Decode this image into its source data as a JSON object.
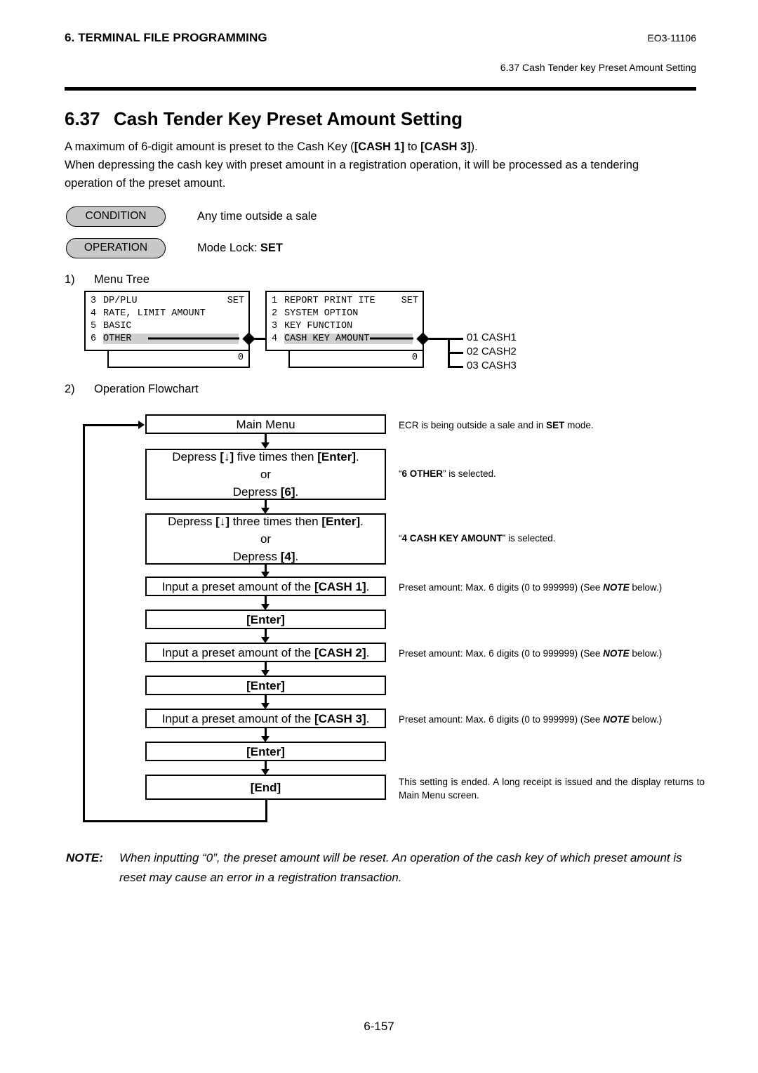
{
  "header": {
    "chapter": "6. TERMINAL FILE PROGRAMMING",
    "doc_code": "EO3-11106",
    "running_head": "6.37 Cash Tender key Preset Amount Setting"
  },
  "section": {
    "number": "6.37",
    "title": "Cash Tender Key Preset Amount Setting",
    "intro_line1_pre": "A maximum of 6-digit amount is preset to the Cash Key (",
    "intro_key1": "[CASH 1]",
    "intro_line1_mid": " to ",
    "intro_key2": "[CASH 3]",
    "intro_line1_post": ").",
    "intro_line2": "When depressing the cash key with preset amount in a registration operation, it will be processed as a tendering",
    "intro_line3": "operation of the preset amount."
  },
  "condition": {
    "badge": "CONDITION",
    "text": "Any time outside a sale"
  },
  "operation": {
    "badge": "OPERATION",
    "text_pre": "Mode Lock: ",
    "text_bold": "SET"
  },
  "subsections": {
    "one_index": "1)",
    "one_label": "Menu Tree",
    "two_index": "2)",
    "two_label": "Operation Flowchart"
  },
  "menu_tree": {
    "panel1": {
      "rows": [
        {
          "index": "3",
          "label": "DP/PLU",
          "right": "SET",
          "selected": false
        },
        {
          "index": "4",
          "label": "RATE, LIMIT AMOUNT",
          "right": "",
          "selected": false
        },
        {
          "index": "5",
          "label": "BASIC",
          "right": "",
          "selected": false
        },
        {
          "index": "6",
          "label": "OTHER",
          "right": "",
          "selected": true
        }
      ],
      "input_value": "0"
    },
    "panel2": {
      "rows": [
        {
          "index": "1",
          "label": "REPORT PRINT ITE",
          "right": "SET",
          "selected": false
        },
        {
          "index": "2",
          "label": "SYSTEM OPTION",
          "right": "",
          "selected": false
        },
        {
          "index": "3",
          "label": "KEY FUNCTION",
          "right": "",
          "selected": false
        },
        {
          "index": "4",
          "label": "CASH KEY AMOUNT",
          "right": "",
          "selected": true
        }
      ],
      "input_value": "0"
    },
    "branches": [
      "01 CASH1",
      "02 CASH2",
      "03 CASH3"
    ]
  },
  "flowchart": {
    "steps": [
      {
        "name": "main-menu",
        "lines": [
          {
            "text": "Main Menu",
            "bold": false
          }
        ],
        "note": "ECR is being outside a sale and in SET mode.",
        "note_bold": "SET"
      },
      {
        "name": "select-other",
        "lines": [
          {
            "text": "Depress [↓] five times then [Enter].",
            "bold": false
          },
          {
            "text": "or",
            "bold": false
          },
          {
            "text": "Depress [6].",
            "bold": false
          }
        ],
        "note": "“6 OTHER” is selected.",
        "note_bold": "6 OTHER"
      },
      {
        "name": "select-cash-key-amount",
        "lines": [
          {
            "text": "Depress [↓] three times then [Enter].",
            "bold": false
          },
          {
            "text": "or",
            "bold": false
          },
          {
            "text": "Depress [4].",
            "bold": false
          }
        ],
        "note": "“4 CASH KEY AMOUNT” is selected.",
        "note_bold": "4 CASH KEY AMOUNT"
      },
      {
        "name": "input-cash1",
        "lines": [
          {
            "text": "Input a preset amount of the [CASH 1].",
            "bold": false
          }
        ],
        "note": "Preset amount: Max. 6 digits (0 to 999999) (See NOTE below.)",
        "note_bold": "NOTE"
      },
      {
        "name": "enter-1",
        "lines": [
          {
            "text": "[Enter]",
            "bold": true
          }
        ],
        "note": ""
      },
      {
        "name": "input-cash2",
        "lines": [
          {
            "text": "Input a preset amount of the [CASH 2].",
            "bold": false
          }
        ],
        "note": "Preset amount: Max. 6 digits (0 to 999999) (See NOTE below.)",
        "note_bold": "NOTE"
      },
      {
        "name": "enter-2",
        "lines": [
          {
            "text": "[Enter]",
            "bold": true
          }
        ],
        "note": ""
      },
      {
        "name": "input-cash3",
        "lines": [
          {
            "text": "Input a preset amount of the [CASH 3].",
            "bold": false
          }
        ],
        "note": "Preset amount: Max. 6 digits (0 to 999999) (See NOTE below.)",
        "note_bold": "NOTE"
      },
      {
        "name": "enter-3",
        "lines": [
          {
            "text": "[Enter]",
            "bold": true
          }
        ],
        "note": ""
      },
      {
        "name": "end",
        "lines": [
          {
            "text": "[End]",
            "bold": true
          }
        ],
        "note": "This setting is ended.   A long receipt is issued and the display returns to Main Menu screen."
      }
    ]
  },
  "note": {
    "label": "NOTE:",
    "line1": "When inputting “0”, the preset amount will be reset.  An operation of the cash key of which preset",
    "line2": "amount is reset may cause an error in a registration transaction."
  },
  "footer": {
    "page": "6-157"
  }
}
